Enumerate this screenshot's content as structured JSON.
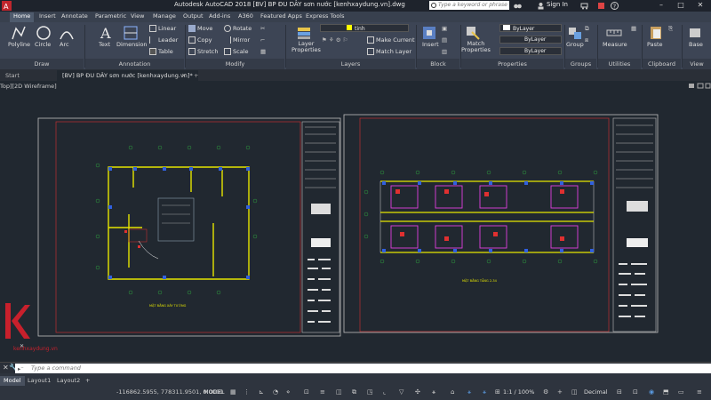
{
  "app": {
    "title": "Autodesk AutoCAD 2018   [BV] BP ĐU DÂY sơn nước [kenhxaydung.vn].dwg",
    "search_placeholder": "Type a keyword or phrase",
    "sign_in": "Sign In"
  },
  "menu": {
    "tabs": [
      "Home",
      "Insert",
      "Annotate",
      "Parametric",
      "View",
      "Manage",
      "Output",
      "Add-ins",
      "A360",
      "Featured Apps",
      "Express Tools"
    ]
  },
  "ribbon": {
    "draw": {
      "title": "Draw",
      "polyline": "Polyline",
      "circle": "Circle",
      "arc": "Arc"
    },
    "annotation": {
      "title": "Annotation",
      "text": "Text",
      "dimension": "Dimension",
      "linear": "Linear",
      "leader": "Leader",
      "table": "Table"
    },
    "modify": {
      "title": "Modify",
      "move": "Move",
      "copy": "Copy",
      "stretch": "Stretch",
      "rotate": "Rotate",
      "mirror": "Mirror",
      "scale": "Scale"
    },
    "layers": {
      "title": "Layers",
      "layer_properties": "Layer\nProperties",
      "current_layer": "tinh",
      "make_current": "Make Current",
      "match_layer": "Match Layer"
    },
    "block": {
      "title": "Block",
      "insert": "Insert"
    },
    "properties": {
      "title": "Properties",
      "match": "Match\nProperties",
      "bylayer1": "ByLayer",
      "bylayer2": "ByLayer",
      "bylayer3": "ByLayer"
    },
    "groups": {
      "title": "Groups",
      "group": "Group"
    },
    "utilities": {
      "title": "Utilities",
      "measure": "Measure"
    },
    "clipboard": {
      "title": "Clipboard",
      "paste": "Paste"
    },
    "view": {
      "title": "View",
      "base": "Base"
    }
  },
  "file_tabs": {
    "start": "Start",
    "current": "[BV] BP ĐU DÂY sơn nước [kenhxaydung.vn]*"
  },
  "viewport": {
    "label": "Top][2D Wireframe]",
    "left_sheet_caption": "MẶT BẰNG XÂY TƯỜNG",
    "right_sheet_caption": "MẶT BẰNG TẦNG 2-34",
    "watermark": "kenhxaydung.vn"
  },
  "command": {
    "placeholder": "Type a command"
  },
  "status": {
    "layout_tabs": [
      "Model",
      "Layout1",
      "Layout2"
    ],
    "coords": "-116862.5955, 778311.9501, 0.0000",
    "model": "MODEL",
    "scale": "1:1 / 100%",
    "units": "Decimal"
  },
  "colors": {
    "accent_blue": "#2a6ad8",
    "watermark_red": "#c8202c",
    "layer_swatch": "#ffff00"
  }
}
